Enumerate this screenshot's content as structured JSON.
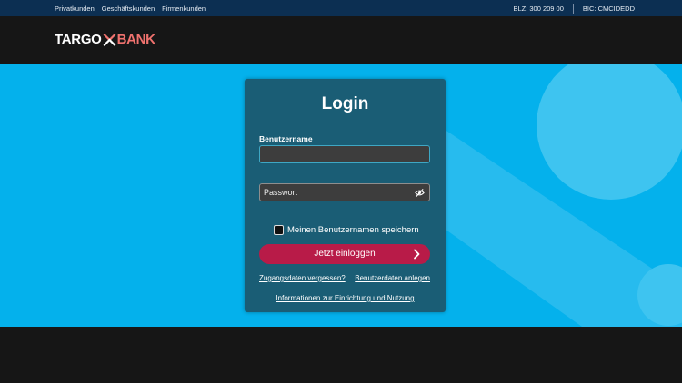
{
  "topbar": {
    "links": [
      "Privatkunden",
      "Geschäftskunden",
      "Firmenkunden"
    ],
    "blz": "BLZ: 300 209 00",
    "bic": "BIC: CMCIDEDD"
  },
  "logo": {
    "word1": "TARGO",
    "word2": "BANK"
  },
  "login": {
    "title": "Login",
    "username_label": "Benutzername",
    "username_value": "",
    "password_placeholder": "Passwort",
    "remember_label": "Meinen Benutzernamen speichern",
    "remember_checked": false,
    "submit_label": "Jetzt einloggen",
    "forgot_link": "Zugangsdaten vergessen?",
    "register_link": "Benutzerdaten anlegen",
    "info_link": "Informationen zur Einrichtung und Nutzung"
  },
  "icons": {
    "logo_mark": "targo-x-icon",
    "password_toggle": "eye-off-icon",
    "submit": "chevron-right-icon"
  },
  "colors": {
    "hero": "#04b1ec",
    "card": "#1a5d75",
    "button": "#b81b48",
    "topbar": "#0c2f52",
    "logo_bank": "#f0726e"
  }
}
